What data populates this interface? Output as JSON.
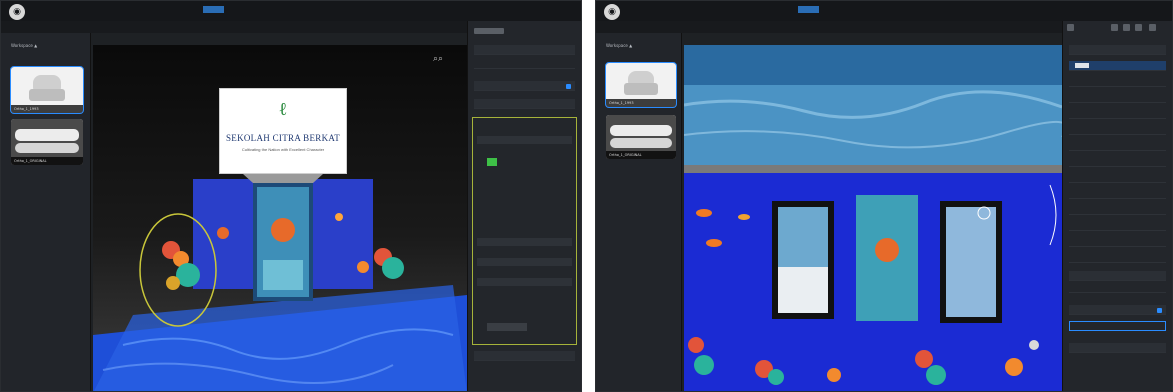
{
  "left_view": {
    "library_title": "Workspace ▲",
    "thumbnails": [
      {
        "caption": "Ortho_1_1993"
      },
      {
        "caption": "Ortho_1_ORIGINAL"
      }
    ],
    "banner": {
      "title": "SEKOLAH CITRA BERKAT",
      "subtitle": "Cultivating the Nation with Excellent Character"
    }
  },
  "right_view": {
    "library_title": "Workspace ▲",
    "thumbnails": [
      {
        "caption": "Ortho_1_1993"
      },
      {
        "caption": "Ortho_1_ORIGINAL"
      }
    ]
  },
  "colors": {
    "accent": "#2a8cff",
    "ocean": "#1b2bd3",
    "panel_bg": "#23262b",
    "highlight_green": "#a6b33a"
  },
  "icons": [
    "app-logo-icon",
    "zoom-icon",
    "orbit-icon",
    "eye-icon",
    "lock-icon"
  ]
}
